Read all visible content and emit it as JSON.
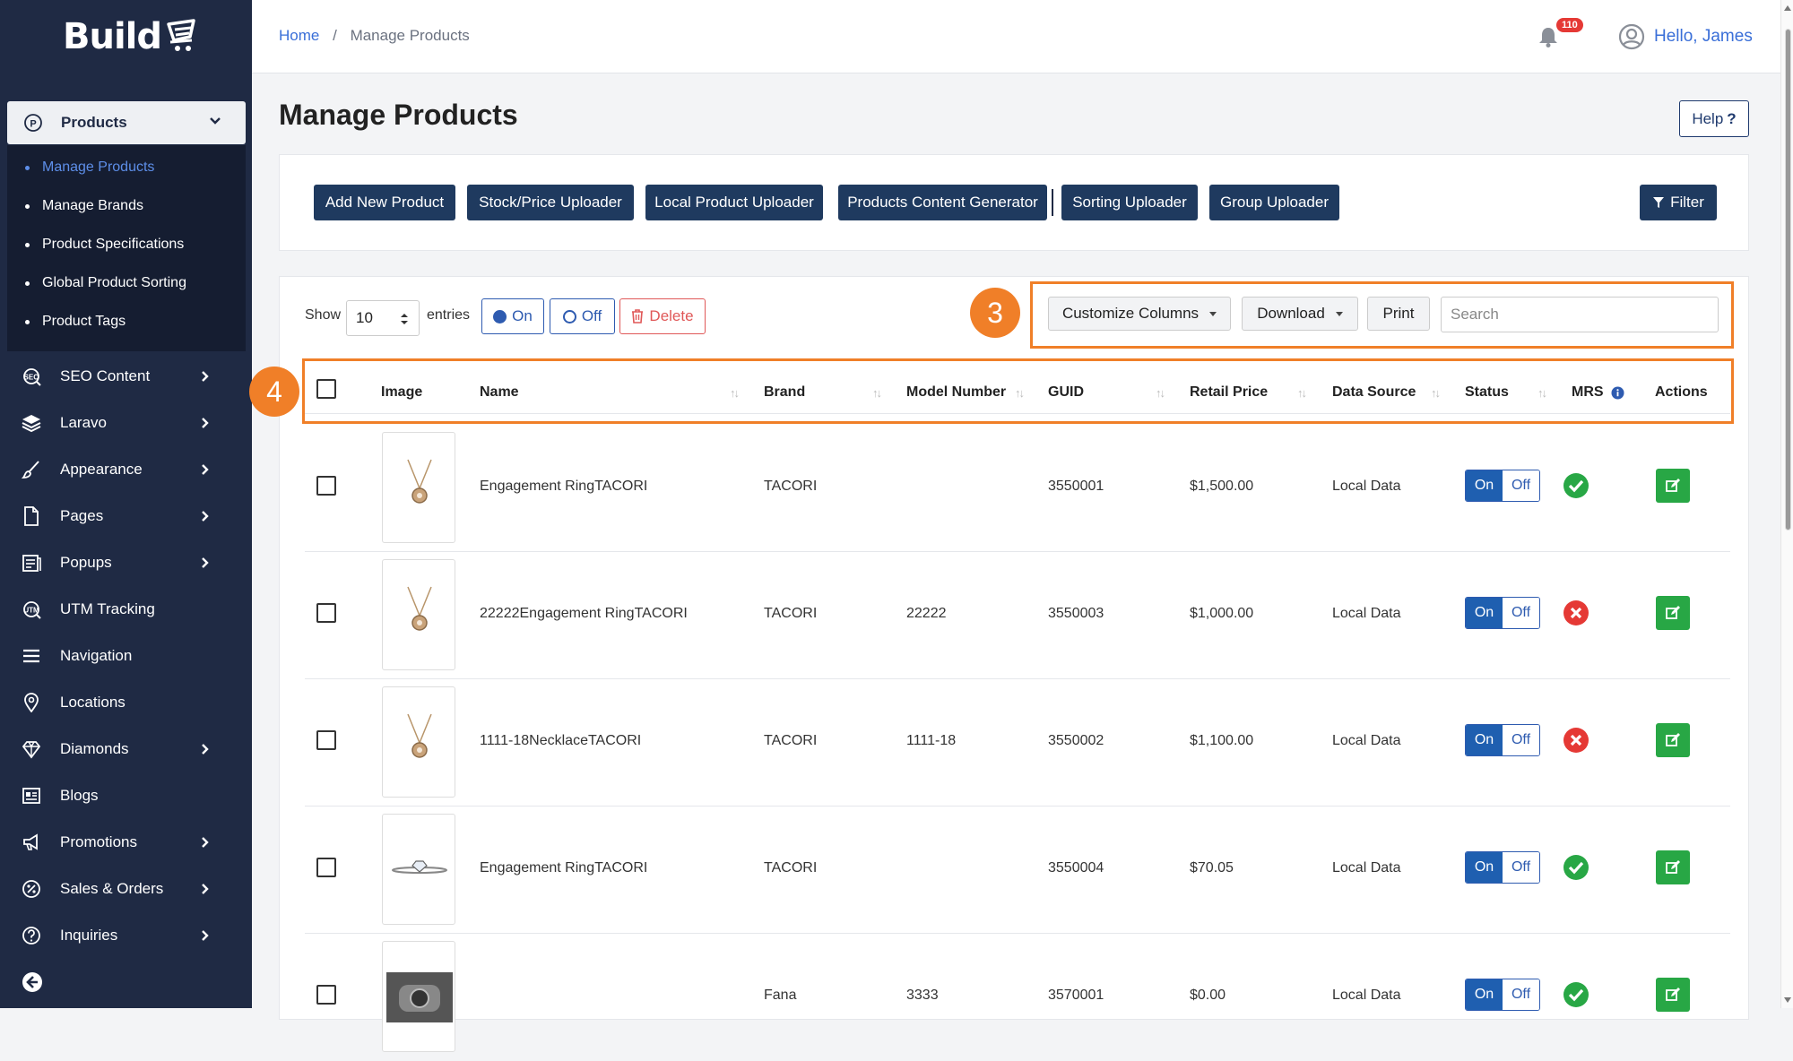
{
  "app": {
    "logo_text": "Build"
  },
  "sidebar": {
    "products_label": "Products",
    "subitems": [
      {
        "label": "Manage Products",
        "active": true
      },
      {
        "label": "Manage Brands",
        "active": false
      },
      {
        "label": "Product Specifications",
        "active": false
      },
      {
        "label": "Global Product Sorting",
        "active": false
      },
      {
        "label": "Product Tags",
        "active": false
      }
    ],
    "items": [
      {
        "label": "SEO Content",
        "icon": "seo-icon",
        "has_children": true
      },
      {
        "label": "Laravo",
        "icon": "layers-icon",
        "has_children": true
      },
      {
        "label": "Appearance",
        "icon": "brush-icon",
        "has_children": true
      },
      {
        "label": "Pages",
        "icon": "page-icon",
        "has_children": true
      },
      {
        "label": "Popups",
        "icon": "popup-icon",
        "has_children": true
      },
      {
        "label": "UTM Tracking",
        "icon": "tracking-icon",
        "has_children": false
      },
      {
        "label": "Navigation",
        "icon": "menu-icon",
        "has_children": false
      },
      {
        "label": "Locations",
        "icon": "location-pin-icon",
        "has_children": false
      },
      {
        "label": "Diamonds",
        "icon": "diamond-icon",
        "has_children": true
      },
      {
        "label": "Blogs",
        "icon": "blog-icon",
        "has_children": false
      },
      {
        "label": "Promotions",
        "icon": "megaphone-icon",
        "has_children": true
      },
      {
        "label": "Sales & Orders",
        "icon": "percent-icon",
        "has_children": true
      },
      {
        "label": "Inquiries",
        "icon": "question-icon",
        "has_children": true
      }
    ]
  },
  "header": {
    "breadcrumb_home": "Home",
    "breadcrumb_sep": "/",
    "breadcrumb_current": "Manage Products",
    "notification_count": "110",
    "greeting": "Hello, James"
  },
  "page": {
    "title": "Manage Products",
    "help_label": "Help",
    "help_icon": "?"
  },
  "toolbar": {
    "buttons": [
      "Add New Product",
      "Stock/Price Uploader",
      "Local Product Uploader",
      "Products Content Generator",
      "Sorting Uploader",
      "Group Uploader"
    ],
    "filter_label": "Filter"
  },
  "table_controls": {
    "show_label": "Show",
    "entries_value": "10",
    "entries_label": "entries",
    "on_label": "On",
    "off_label": "Off",
    "delete_label": "Delete",
    "customize_label": "Customize Columns",
    "download_label": "Download",
    "print_label": "Print",
    "search_placeholder": "Search",
    "callout_3": "3",
    "callout_4": "4"
  },
  "table": {
    "columns": [
      "Image",
      "Name",
      "Brand",
      "Model Number",
      "GUID",
      "Retail Price",
      "Data Source",
      "Status",
      "MRS",
      "Actions"
    ],
    "rows": [
      {
        "name": "Engagement RingTACORI",
        "brand": "TACORI",
        "model": "",
        "guid": "3550001",
        "price": "$1,500.00",
        "source": "Local Data",
        "status_on": "On",
        "status_off": "Off",
        "mrs": "ok",
        "image": "necklace"
      },
      {
        "name": "22222Engagement RingTACORI",
        "brand": "TACORI",
        "model": "22222",
        "guid": "3550003",
        "price": "$1,000.00",
        "source": "Local Data",
        "status_on": "On",
        "status_off": "Off",
        "mrs": "fail",
        "image": "necklace"
      },
      {
        "name": "1111-18NecklaceTACORI",
        "brand": "TACORI",
        "model": "1111-18",
        "guid": "3550002",
        "price": "$1,100.00",
        "source": "Local Data",
        "status_on": "On",
        "status_off": "Off",
        "mrs": "fail",
        "image": "necklace"
      },
      {
        "name": "Engagement RingTACORI",
        "brand": "TACORI",
        "model": "",
        "guid": "3550004",
        "price": "$70.05",
        "source": "Local Data",
        "status_on": "On",
        "status_off": "Off",
        "mrs": "ok",
        "image": "ring"
      },
      {
        "name": "",
        "brand": "Fana",
        "model": "3333",
        "guid": "3570001",
        "price": "$0.00",
        "source": "Local Data",
        "status_on": "On",
        "status_off": "Off",
        "mrs": "ok",
        "image": "watch"
      }
    ]
  },
  "colors": {
    "sidebar_bg": "#1f2a44",
    "accent_blue": "#3a6fd8",
    "callout_orange": "#f07f28",
    "success_green": "#28a745",
    "danger_red": "#e53935"
  }
}
